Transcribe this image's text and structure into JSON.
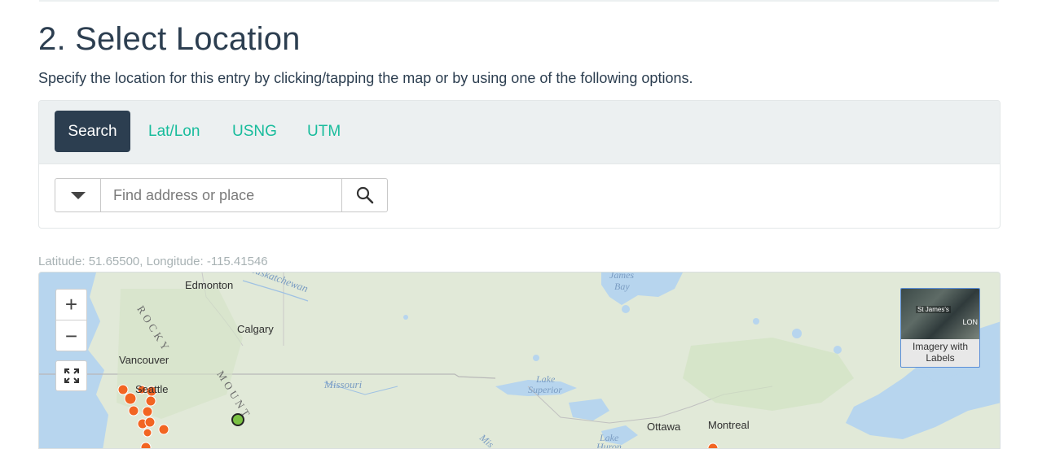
{
  "section": {
    "title": "2. Select Location",
    "description": "Specify the location for this entry by clicking/tapping the map or by using one of the following options."
  },
  "tabs": [
    {
      "label": "Search",
      "active": true
    },
    {
      "label": "Lat/Lon",
      "active": false
    },
    {
      "label": "USNG",
      "active": false
    },
    {
      "label": "UTM",
      "active": false
    }
  ],
  "search": {
    "placeholder": "Find address or place",
    "value": ""
  },
  "coordinates": {
    "text": "Latitude: 51.65500,  Longitude: -115.41546"
  },
  "map": {
    "zoom_in": "+",
    "zoom_out": "−",
    "basemap": {
      "label": "Imagery with Labels",
      "thumb_text_1": "St James's",
      "thumb_text_2": "LON"
    },
    "labels": {
      "edmonton": "Edmonton",
      "saskatchewan": "Saskatchewan",
      "calgary": "Calgary",
      "vancouver": "Vancouver",
      "seattle": "Seattle",
      "missouri": "Missouri",
      "lake_superior_1": "Lake",
      "lake_superior_2": "Superior",
      "james_bay_1": "James",
      "james_bay_2": "Bay",
      "ottawa": "Ottawa",
      "montreal": "Montreal",
      "lake_huron": "Lake",
      "huron": "Huron",
      "rocky": "ROCKY",
      "mountains": "MOUNT",
      "miss": "Mis"
    },
    "colors": {
      "land": "#dfe8d6",
      "water": "#b7d5ee",
      "marker_orange": "#f26522",
      "marker_green": "#7ac143",
      "accent_tab": "#2c3e50",
      "link": "#18bc9c"
    }
  }
}
